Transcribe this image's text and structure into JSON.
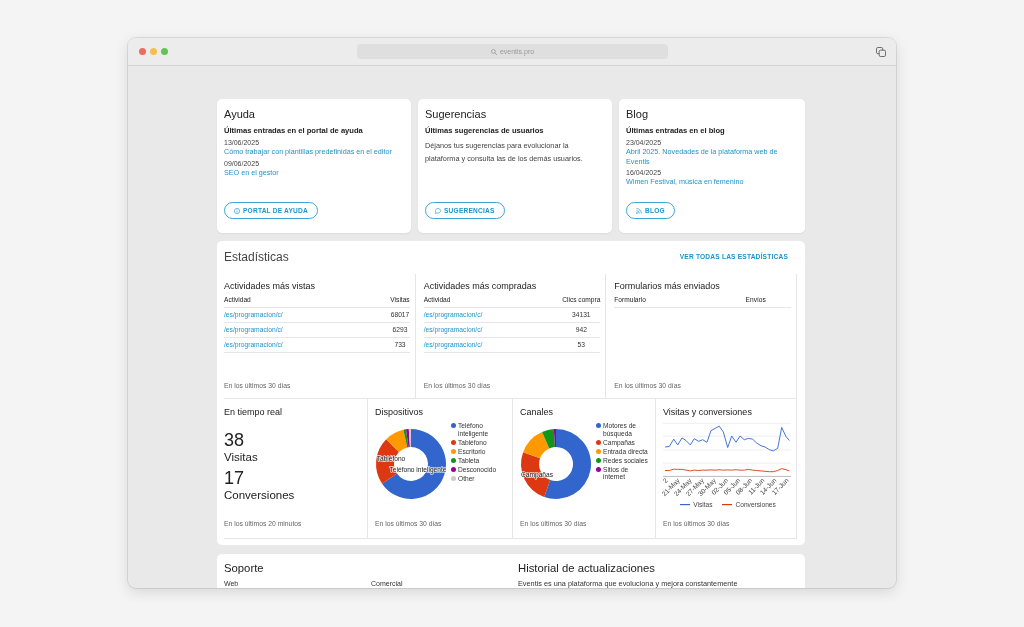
{
  "browser": {
    "url": "eventis.pro"
  },
  "cards": [
    {
      "title": "Ayuda",
      "subtitle": "Últimas entradas en el portal de ayuda",
      "entries": [
        {
          "date": "13/06/2025",
          "link": "Cómo trabajar con plantillas predefinidas en el editor"
        },
        {
          "date": "09/06/2025",
          "link": "SEO en el gestor"
        }
      ],
      "button": "PORTAL DE AYUDA"
    },
    {
      "title": "Sugerencias",
      "subtitle": "Últimas sugerencias de usuarios",
      "text": "Déjanos tus sugerencias para evolucionar la plataforma y consulta las de los demás usuarios.",
      "button": "SUGERENCIAS"
    },
    {
      "title": "Blog",
      "subtitle": "Últimas entradas en el blog",
      "entries": [
        {
          "date": "23/04/2025",
          "link": "Abril 2025. Novedades de la plataforma web de Eventis"
        },
        {
          "date": "16/04/2025",
          "link": "Wimen Festival, música en femenino"
        }
      ],
      "button": "BLOG"
    }
  ],
  "statistics": {
    "title": "Estadísticas",
    "link": "VER TODAS LAS ESTADÍSTICAS",
    "tables": [
      {
        "title": "Actividades más vistas",
        "columns": [
          "Actividad",
          "Visitas"
        ],
        "rows": [
          {
            "activity": "/es/programacion/c/",
            "count": "68017"
          },
          {
            "activity": "/es/programacion/c/",
            "count": "6293"
          },
          {
            "activity": "/es/programacion/c/",
            "count": "733"
          }
        ],
        "footer": "En los últimos 30 días"
      },
      {
        "title": "Actividades más compradas",
        "columns": [
          "Actividad",
          "Clics compra"
        ],
        "rows": [
          {
            "activity": "/es/programacion/c/",
            "count": "34131"
          },
          {
            "activity": "/es/programacion/c/",
            "count": "942"
          },
          {
            "activity": "/es/programacion/c/",
            "count": "53"
          }
        ],
        "footer": "En los últimos 30 días"
      },
      {
        "title": "Formularios más enviados",
        "columns": [
          "Formulario",
          "Envíos"
        ],
        "footer": "En los últimos 30 días"
      }
    ],
    "realtime": {
      "title": "En tiempo real",
      "metrics": [
        {
          "value": "38",
          "label": "Visitas"
        },
        {
          "value": "17",
          "label": "Conversiones"
        }
      ],
      "footer": "En los últimos 20 minutos"
    },
    "donuts": [
      {
        "title": "Dispositivos",
        "slice_labels": [
          "Tabléfono",
          "Teléfono inteligente"
        ],
        "legend": [
          {
            "label": "Teléfono inteligente",
            "color": "#3366cc"
          },
          {
            "label": "Tabléfono",
            "color": "#dc3912"
          },
          {
            "label": "Escritorio",
            "color": "#ff9900"
          },
          {
            "label": "Tableta",
            "color": "#109618"
          },
          {
            "label": "Desconocido",
            "color": "#990099"
          },
          {
            "label": "Other",
            "color": "#cccccc"
          }
        ],
        "footer": "En los últimos 30 días"
      },
      {
        "title": "Canales",
        "slice_labels": [
          "Campañas"
        ],
        "legend": [
          {
            "label": "Motores de búsqueda",
            "color": "#3366cc"
          },
          {
            "label": "Campañas",
            "color": "#dc3912"
          },
          {
            "label": "Entrada directa",
            "color": "#ff9900"
          },
          {
            "label": "Redes sociales",
            "color": "#109618"
          },
          {
            "label": "Sitios de internet",
            "color": "#990099"
          }
        ],
        "footer": "En los últimos 30 días"
      }
    ],
    "line_chart": {
      "title": "Visitas y conversiones",
      "x_labels": [
        "2",
        "21-May",
        "24-May",
        "27-May",
        "30-May",
        "02-Jun",
        "05-Jun",
        "08-Jun",
        "11-Jun",
        "14-Jun",
        "17-Jun"
      ],
      "series": [
        {
          "name": "Visitas",
          "color": "#3366cc"
        },
        {
          "name": "Conversiones",
          "color": "#dc3912"
        }
      ],
      "footer": "En los últimos 30 días"
    }
  },
  "bottom": {
    "support": {
      "title": "Soporte",
      "columns": [
        "Web",
        "Comercial"
      ]
    },
    "updates": {
      "title": "Historial de actualizaciones",
      "text": "Eventis es una plataforma que evoluciona y mejora constantemente"
    }
  }
}
